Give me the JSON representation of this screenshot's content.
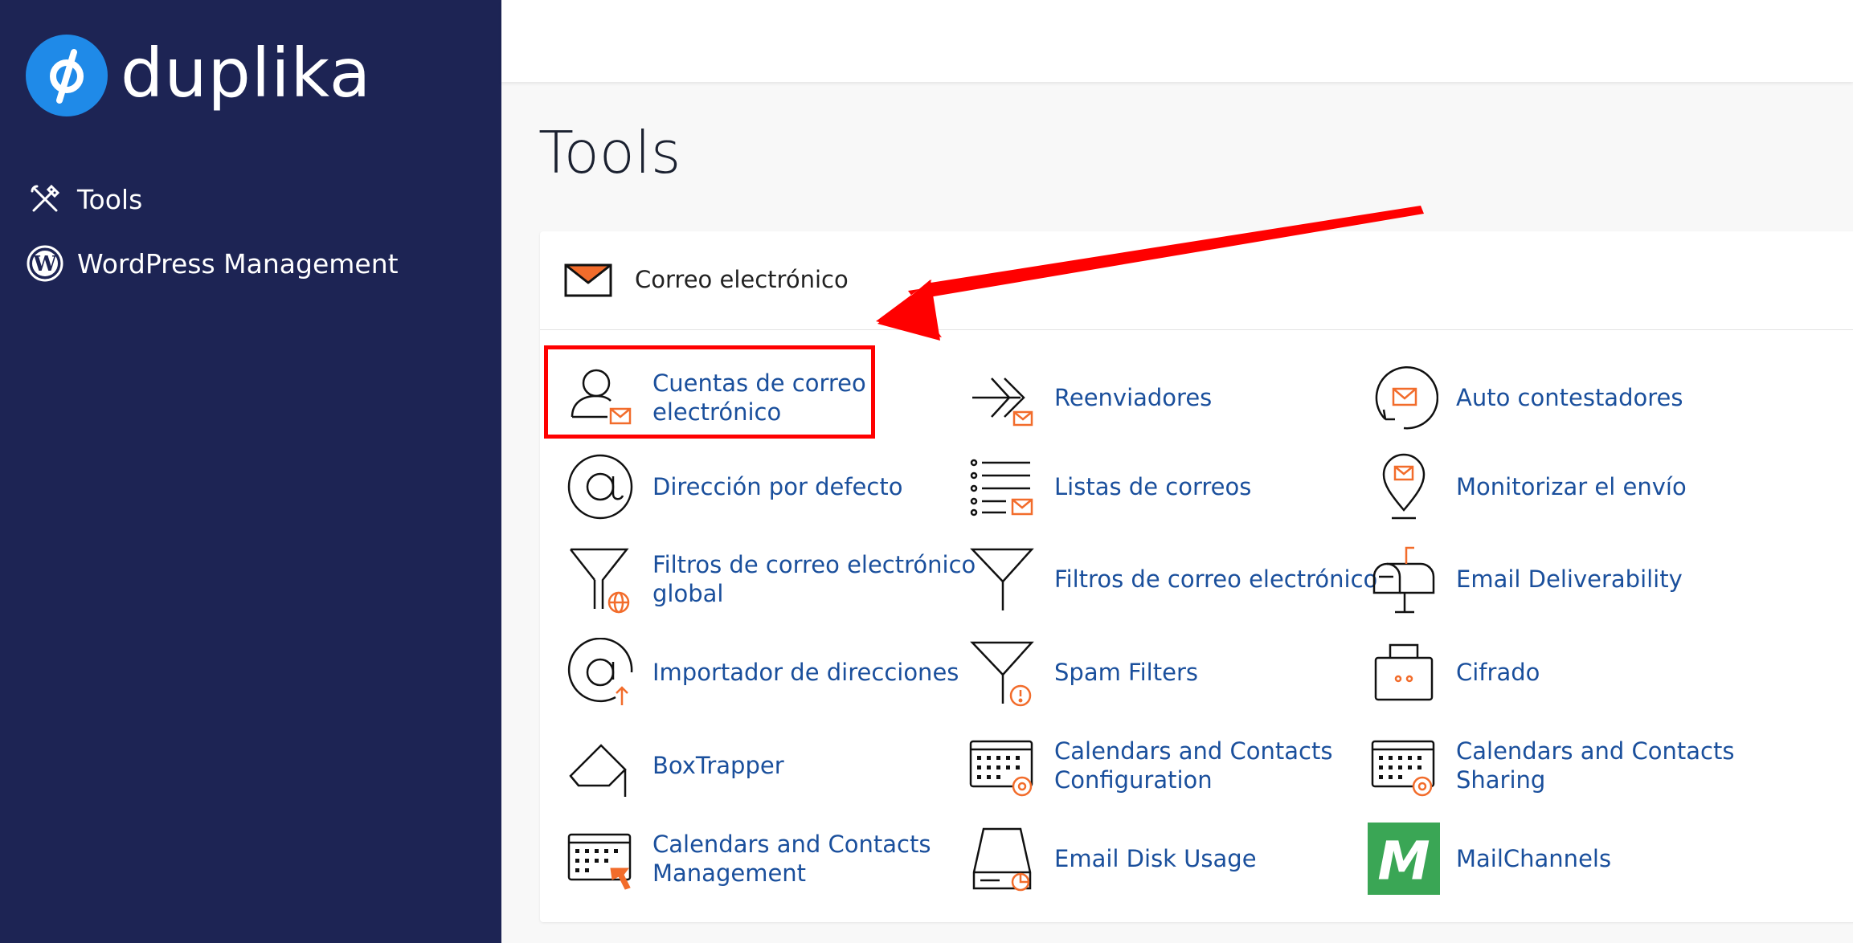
{
  "brand": {
    "name": "duplika"
  },
  "sidebar": {
    "items": [
      {
        "label": "Tools",
        "icon": "tools-icon"
      },
      {
        "label": "WordPress Management",
        "icon": "wordpress-icon"
      }
    ]
  },
  "page": {
    "title": "Tools"
  },
  "section": {
    "title": "Correo electrónico",
    "icon": "envelope-icon",
    "tools": [
      {
        "label": "Cuentas de correo\nelectrónico",
        "icon": "email-accounts-icon",
        "highlighted": true
      },
      {
        "label": "Reenviadores",
        "icon": "forwarders-icon"
      },
      {
        "label": "Auto contestadores",
        "icon": "autoresponders-icon"
      },
      {
        "label": "Dirección por defecto",
        "icon": "default-address-icon"
      },
      {
        "label": "Listas de correos",
        "icon": "mailing-lists-icon"
      },
      {
        "label": "Monitorizar el envío",
        "icon": "track-delivery-icon"
      },
      {
        "label": "Filtros de correo electrónico\nglobal",
        "icon": "global-filter-icon"
      },
      {
        "label": "Filtros de correo electrónico",
        "icon": "email-filter-icon"
      },
      {
        "label": "Email Deliverability",
        "icon": "mailbox-icon"
      },
      {
        "label": "Importador de direcciones",
        "icon": "address-importer-icon"
      },
      {
        "label": "Spam Filters",
        "icon": "spam-filter-icon"
      },
      {
        "label": "Cifrado",
        "icon": "encryption-icon"
      },
      {
        "label": "BoxTrapper",
        "icon": "boxtrapper-icon"
      },
      {
        "label": "Calendars and Contacts\nConfiguration",
        "icon": "calendar-config-icon"
      },
      {
        "label": "Calendars and Contacts\nSharing",
        "icon": "calendar-sharing-icon"
      },
      {
        "label": "Calendars and Contacts\nManagement",
        "icon": "calendar-management-icon"
      },
      {
        "label": "Email Disk Usage",
        "icon": "disk-usage-icon"
      },
      {
        "label": "MailChannels",
        "icon": "mailchannels-logo-icon",
        "icon_text": "M"
      }
    ]
  },
  "colors": {
    "sidebar": "#1d2454",
    "accent": "#1f8ae8",
    "link": "#1a4f9c",
    "orange": "#f26c2b",
    "annotation": "#ff0000",
    "mailchannels": "#3aa655"
  }
}
